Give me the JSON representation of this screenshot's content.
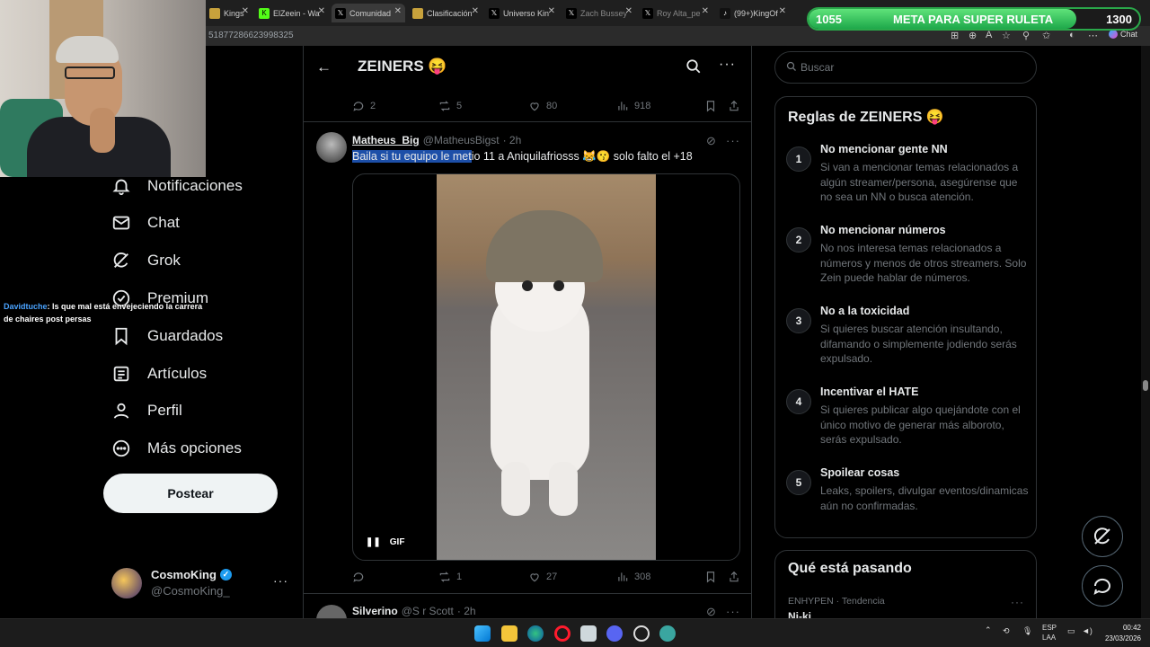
{
  "browser": {
    "tabs": [
      {
        "label": "Kings",
        "icon": "kings-favicon"
      },
      {
        "label": "ElZeein - Wa",
        "icon": "kick-favicon"
      },
      {
        "label": "Comunidad",
        "icon": "x-favicon"
      },
      {
        "label": "Clasificación",
        "icon": "kings-favicon"
      },
      {
        "label": "Universo Kin",
        "icon": "x-favicon"
      },
      {
        "label": "Zach Bussey",
        "icon": "x-favicon"
      },
      {
        "label": "Roy Alta_pe",
        "icon": "x-favicon"
      },
      {
        "label": "(99+)KingOf",
        "icon": "tiktok-favicon"
      }
    ],
    "url": "51877286623998325",
    "chat_button": "Chat"
  },
  "goal_bar": {
    "current": "1055",
    "label": "META PARA SUPER RULETA",
    "target": "1300",
    "progress": 0.81
  },
  "stream_chat": {
    "user": "Davidtuche",
    "message": ": ls que mal está envejeciendo la carrera de chaires post persas"
  },
  "nav": {
    "items": [
      {
        "label": "Notificaciones",
        "icon": "bell-icon"
      },
      {
        "label": "Chat",
        "icon": "mail-icon"
      },
      {
        "label": "Grok",
        "icon": "grok-icon"
      },
      {
        "label": "Premium",
        "icon": "verified-icon"
      },
      {
        "label": "Guardados",
        "icon": "bookmark-icon"
      },
      {
        "label": "Artículos",
        "icon": "article-icon"
      },
      {
        "label": "Perfil",
        "icon": "person-icon"
      },
      {
        "label": "Más opciones",
        "icon": "more-circle-icon"
      }
    ],
    "post_button": "Postear"
  },
  "profile": {
    "name": "CosmoKing",
    "handle": "@CosmoKing_"
  },
  "community": {
    "title": "ZEINERS 😝"
  },
  "prev_tweet": {
    "replies": "2",
    "retweets": "5",
    "likes": "80",
    "views": "918"
  },
  "tweet": {
    "name": "Matheus_Big",
    "handle": "@MatheusBigst",
    "time": "· 2h",
    "text_selected": "Baila si tu equipo le met",
    "text_rest": "io 11 a Aniquilafriosss 😹😗 solo falto el +18",
    "gif_label": "GIF",
    "replies": "",
    "retweets": "1",
    "likes": "27",
    "views": "308"
  },
  "next_tweet": {
    "name": "Silverino",
    "handle": "@S r Scott",
    "time": "· 2h"
  },
  "sidebar": {
    "search_placeholder": "Buscar",
    "rules_title": "Reglas de ZEINERS 😝",
    "rules": [
      {
        "num": "1",
        "title": "No mencionar gente NN",
        "desc": "Si van a mencionar temas relacionados a algún streamer/persona, asegúrense que no sea un NN o busca atención."
      },
      {
        "num": "2",
        "title": "No mencionar números",
        "desc": "No nos interesa temas relacionados a números y menos de otros streamers. Solo Zein puede hablar de números."
      },
      {
        "num": "3",
        "title": "No a la toxicidad",
        "desc": "Si quieres buscar atención insultando, difamando o simplemente jodiendo serás expulsado."
      },
      {
        "num": "4",
        "title": "Incentivar el HATE",
        "desc": "Si quieres publicar algo quejándote con el único motivo de generar más alboroto, serás expulsado."
      },
      {
        "num": "5",
        "title": "Spoilear cosas",
        "desc": "Leaks, spoilers, divulgar eventos/dinamicas aún no confirmadas."
      }
    ],
    "happening_title": "Qué está pasando",
    "trend_meta": "ENHYPEN · Tendencia",
    "trend_name": "Ni-ki"
  },
  "taskbar": {
    "lang_top": "ESP",
    "lang_bottom": "LAA",
    "time": "00:42",
    "date": "23/03/2026"
  }
}
